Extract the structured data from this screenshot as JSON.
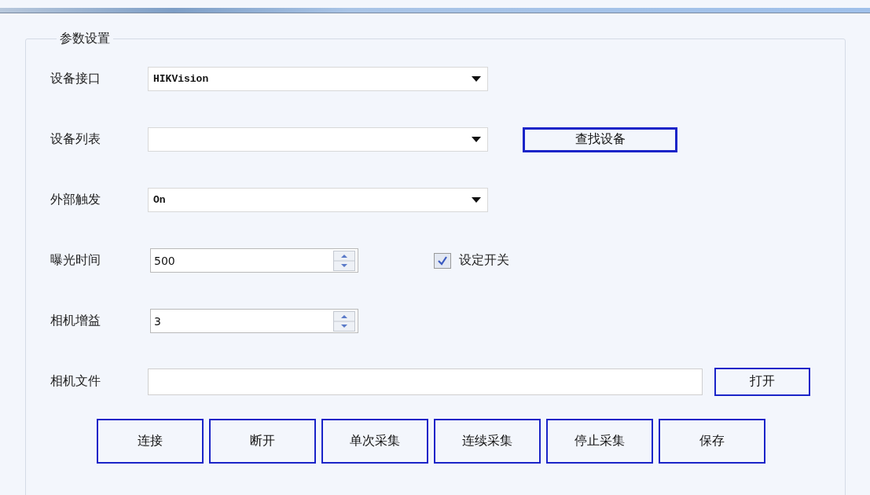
{
  "group": {
    "title": "参数设置"
  },
  "rows": [
    {
      "kind": "combo",
      "label": "设备接口",
      "value": "HIKVision"
    },
    {
      "kind": "combo",
      "label": "设备列表",
      "value": "",
      "button": "查找设备"
    },
    {
      "kind": "combo",
      "label": "外部触发",
      "value": "On"
    },
    {
      "kind": "spin",
      "label": "曝光时间",
      "value": "500",
      "checkbox": {
        "label": "设定开关",
        "checked": true
      }
    },
    {
      "kind": "spin",
      "label": "相机增益",
      "value": "3"
    },
    {
      "kind": "file",
      "label": "相机文件",
      "value": "",
      "button": "打开"
    }
  ],
  "buttons": [
    "连接",
    "断开",
    "单次采集",
    "连续采集",
    "停止采集",
    "保存"
  ]
}
